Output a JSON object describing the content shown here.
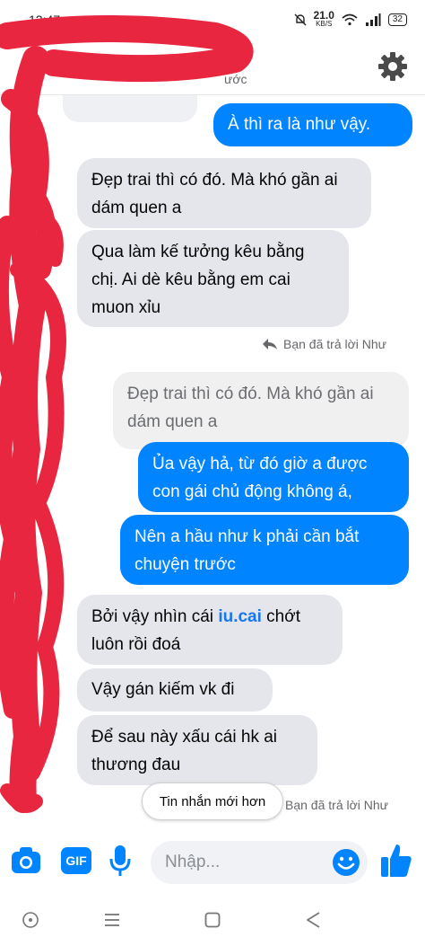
{
  "status": {
    "time": "12:47",
    "speed_value": "21.0",
    "speed_unit": "KB/S",
    "battery": "32"
  },
  "header": {
    "subtitle_fragment": "ước"
  },
  "messages": {
    "m1": "À thì ra là như vậy.",
    "m2": "Đẹp trai thì có đó. Mà khó gần ai dám quen a",
    "m3": "Qua làm kế tưởng kêu bằng chị. Ai dè kêu bằng em cai muon xỉu",
    "reply_note_1": "Bạn đã trả lời Như",
    "quoted": "Đẹp trai thì có đó. Mà khó gần ai dám quen a",
    "m4": "Ủa vậy hả, từ đó giờ a được con gái chủ động không á,",
    "m5": "Nên a hầu như k phải cần bắt chuyện trước",
    "m6_before": "Bởi vậy nhìn cái ",
    "m6_highlight": "iu.cai",
    "m6_after": " chớt luôn rồi đoá",
    "m7": "Vậy gán kiếm vk đi",
    "m8": "Để sau này xấu cái hk ai thương đau",
    "reply_note_2": "Bạn đã trả lời Như"
  },
  "newer_button": "Tin nhắn mới hơn",
  "composer": {
    "placeholder": "Nhập...",
    "gif_label": "GIF"
  },
  "colors": {
    "accent": "#0084ff",
    "incoming": "#e4e6eb",
    "scribble": "#e8263f"
  },
  "icons": [
    "settings-gear-icon",
    "camera-icon",
    "gif-icon",
    "microphone-icon",
    "emoji-icon",
    "thumbs-up-icon",
    "reply-arrow-icon",
    "nav-home-icon",
    "nav-recent-icon",
    "nav-square-icon",
    "nav-back-icon"
  ]
}
